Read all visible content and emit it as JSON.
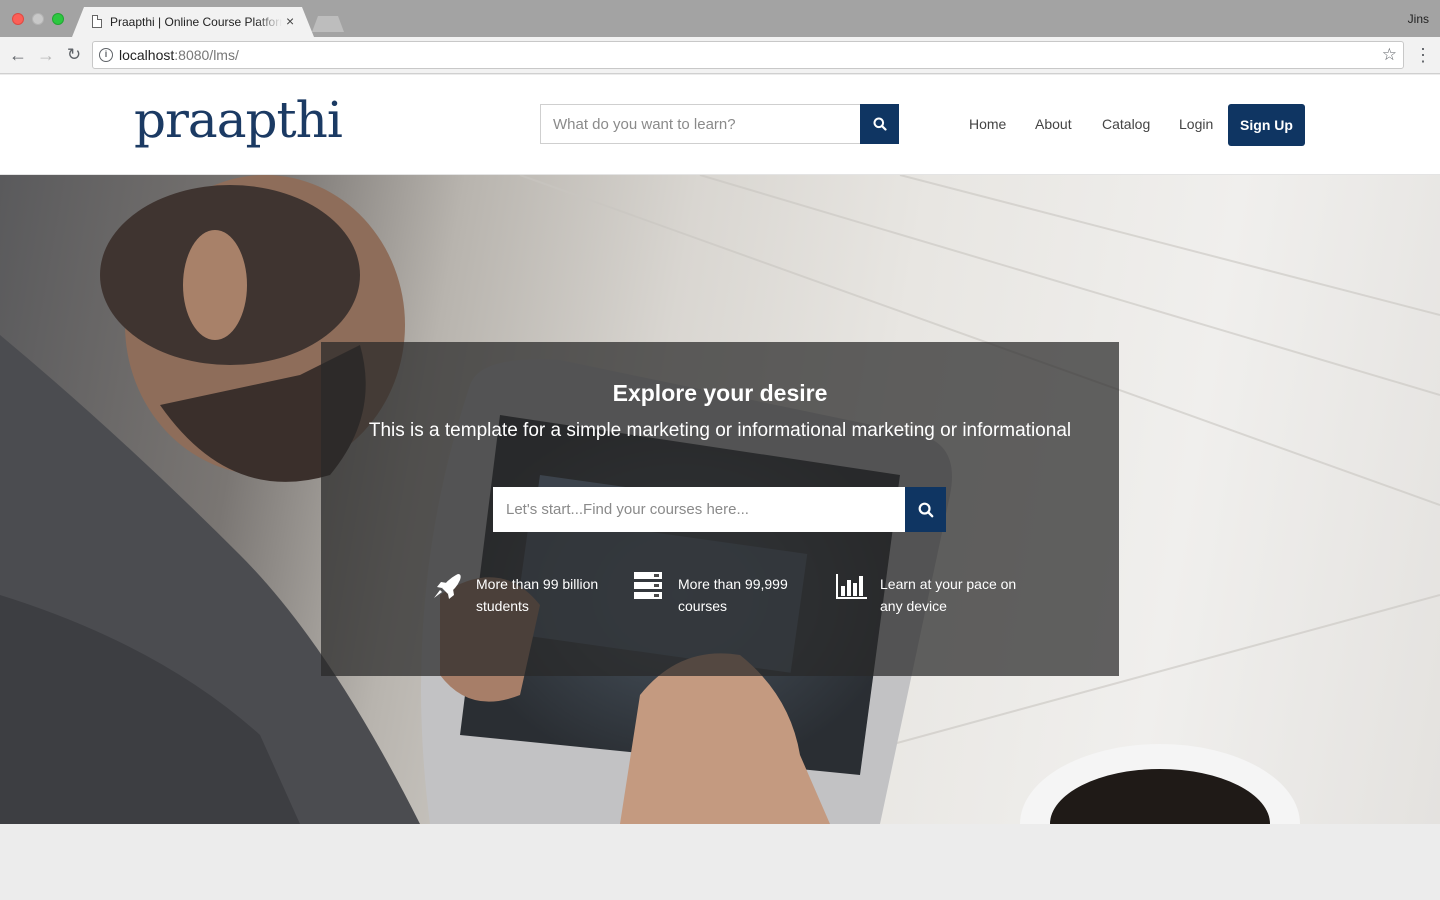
{
  "browser": {
    "tab_title": "Praapthi | Online Course Platform",
    "tab_close": "×",
    "profile_name": "Jins",
    "url_host": "localhost",
    "url_path": ":8080/lms/"
  },
  "header": {
    "logo_text": "praapthi",
    "search_placeholder": "What do you want to learn?",
    "nav": {
      "home": "Home",
      "about": "About",
      "catalog": "Catalog",
      "login": "Login"
    },
    "signup_label": "Sign Up"
  },
  "hero": {
    "title": "Explore your desire",
    "subtitle": "This is a template for a simple marketing or informational marketing or informational",
    "search_placeholder": "Let's start...Find your courses here...",
    "features": [
      {
        "icon": "rocket-icon",
        "text": "More than 99 billion students"
      },
      {
        "icon": "server-icon",
        "text": "More than 99,999 courses"
      },
      {
        "icon": "bar-chart-icon",
        "text": "Learn at your pace on any device"
      }
    ]
  },
  "colors": {
    "brand": "#0f3562",
    "logo": "#1b3a63"
  }
}
